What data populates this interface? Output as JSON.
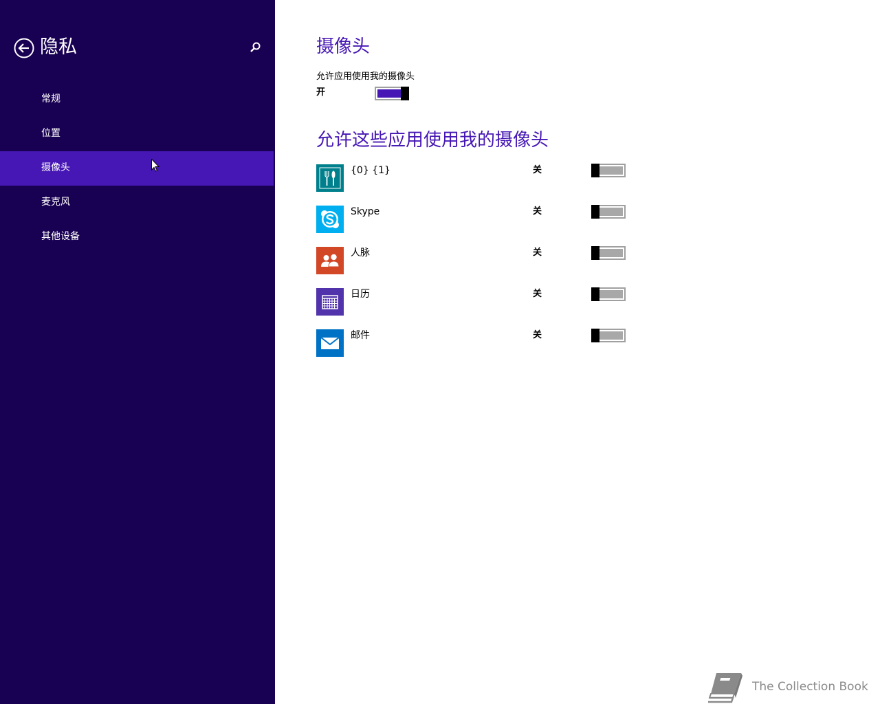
{
  "sidebar": {
    "title": "隐私",
    "back_icon": "back-arrow-icon",
    "search_icon": "search-icon",
    "items": [
      {
        "label": "常规",
        "active": false
      },
      {
        "label": "位置",
        "active": false
      },
      {
        "label": "摄像头",
        "active": true
      },
      {
        "label": "麦克风",
        "active": false
      },
      {
        "label": "其他设备",
        "active": false
      }
    ]
  },
  "main": {
    "title": "摄像头",
    "master_setting": {
      "label": "允许应用使用我的摄像头",
      "state_label": "开",
      "on": true
    },
    "apps_title": "允许这些应用使用我的摄像头",
    "apps": [
      {
        "name": "{0} {1}",
        "state_label": "关",
        "on": false,
        "icon": "fork-knife-icon",
        "tile_color": "#00808c"
      },
      {
        "name": "Skype",
        "state_label": "关",
        "on": false,
        "icon": "skype-icon",
        "tile_color": "#00aff0"
      },
      {
        "name": "人脉",
        "state_label": "关",
        "on": false,
        "icon": "people-icon",
        "tile_color": "#d24726"
      },
      {
        "name": "日历",
        "state_label": "关",
        "on": false,
        "icon": "calendar-icon",
        "tile_color": "#5133ab"
      },
      {
        "name": "邮件",
        "state_label": "关",
        "on": false,
        "icon": "mail-icon",
        "tile_color": "#0072c6"
      }
    ]
  },
  "watermark": {
    "text": "The Collection Book",
    "icon": "book-icon"
  },
  "colors": {
    "sidebar_bg": "#180052",
    "sidebar_active": "#4617b4",
    "accent": "#4617b4",
    "toggle_off_fill": "#a8a8a8"
  }
}
